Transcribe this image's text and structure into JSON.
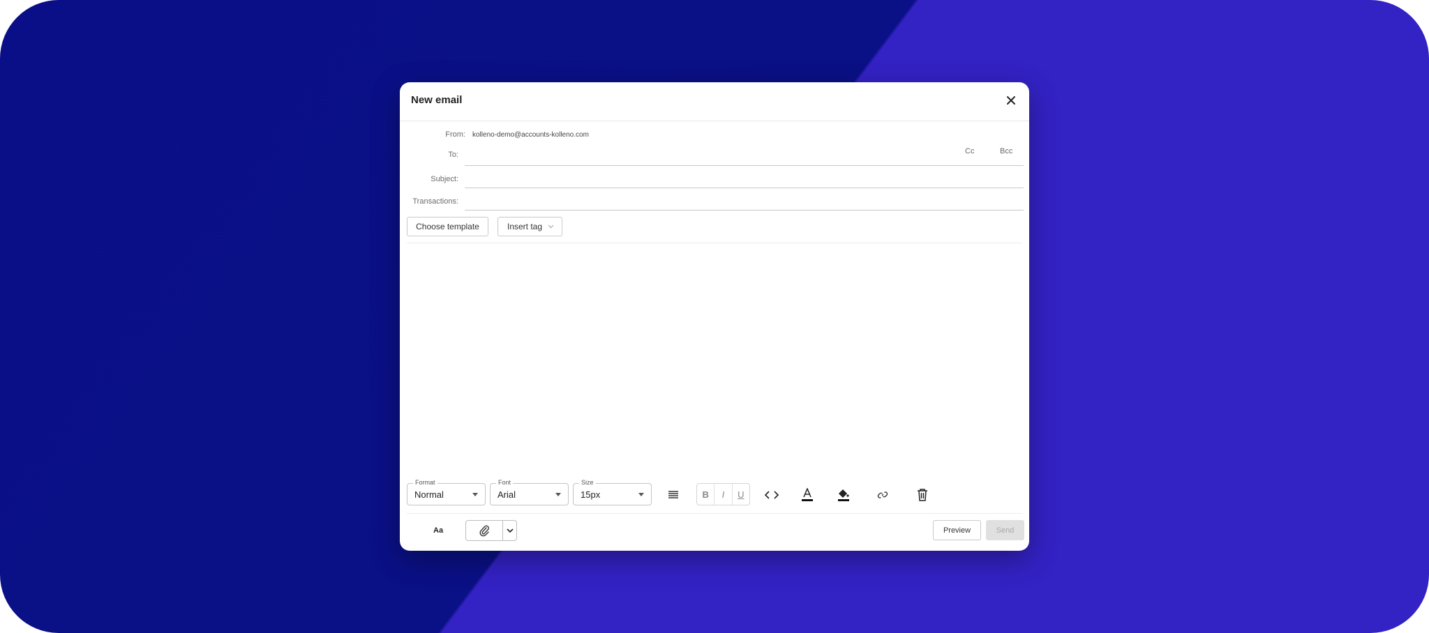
{
  "dialog": {
    "title": "New email",
    "close_icon": "close-icon"
  },
  "fields": {
    "from_label": "From:",
    "from_value": "kolleno-demo@accounts-kolleno.com",
    "to_label": "To:",
    "cc_label": "Cc",
    "bcc_label": "Bcc",
    "subject_label": "Subject:",
    "transactions_label": "Transactions:"
  },
  "actions": {
    "choose_template": "Choose template",
    "insert_tag": "Insert tag"
  },
  "toolbar": {
    "format_legend": "Format",
    "format_value": "Normal",
    "font_legend": "Font",
    "font_value": "Arial",
    "size_legend": "Size",
    "size_value": "15px",
    "bold": "B",
    "italic": "I",
    "underline": "U",
    "icons": [
      "align-justify-icon",
      "code-icon",
      "text-color-icon",
      "fill-color-icon",
      "link-icon",
      "trash-icon"
    ]
  },
  "footer": {
    "aa_label": "Aa",
    "attach_icon": "paperclip-icon",
    "preview_label": "Preview",
    "send_label": "Send"
  },
  "colors": {
    "background_dark": "#0a0f88",
    "background_light": "#3322c4",
    "send_disabled": "#e0e0e0"
  }
}
